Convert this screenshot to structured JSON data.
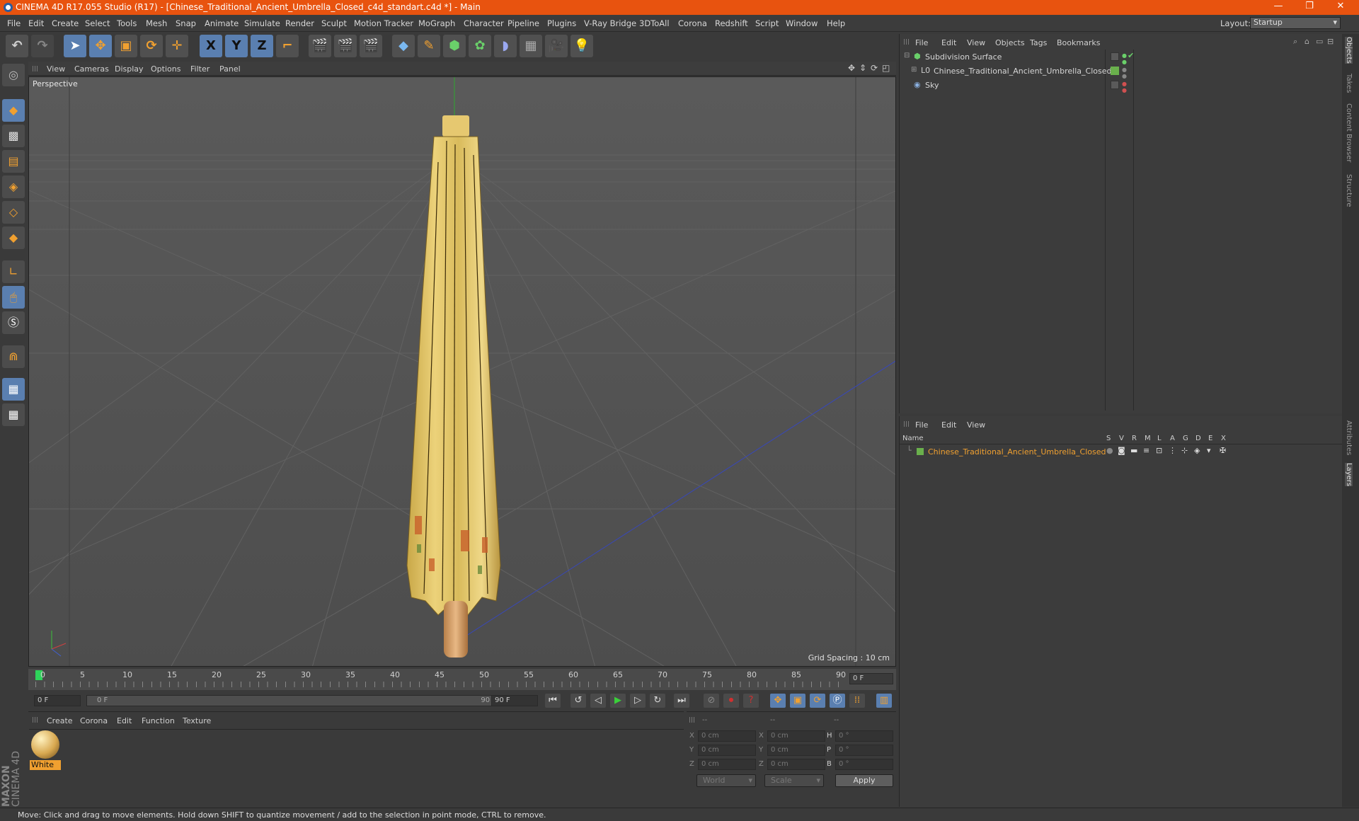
{
  "titlebar": {
    "title": "CINEMA 4D R17.055 Studio (R17) - [Chinese_Traditional_Ancient_Umbrella_Closed_c4d_standart.c4d *] - Main",
    "minimize": "—",
    "restore": "❐",
    "close": "✕"
  },
  "menubar": {
    "items": [
      "File",
      "Edit",
      "Create",
      "Select",
      "Tools",
      "Mesh",
      "Snap",
      "Animate",
      "Simulate",
      "Render",
      "Sculpt",
      "Motion Tracker",
      "MoGraph",
      "Character",
      "Pipeline",
      "Plugins",
      "V-Ray Bridge",
      "3DToAll",
      "Corona",
      "Redshift",
      "Script",
      "Window",
      "Help"
    ],
    "layout_label": "Layout:",
    "layout_value": "Startup"
  },
  "toolbar": {
    "x_label": "X",
    "y_label": "Y",
    "z_label": "Z"
  },
  "viewport": {
    "menu": [
      "View",
      "Cameras",
      "Display",
      "Options",
      "Filter",
      "Panel"
    ],
    "label": "Perspective",
    "grid_spacing": "Grid Spacing : 10 cm"
  },
  "timeline": {
    "ticks": [
      "0",
      "5",
      "10",
      "15",
      "20",
      "25",
      "30",
      "35",
      "40",
      "45",
      "50",
      "55",
      "60",
      "65",
      "70",
      "75",
      "80",
      "85",
      "90"
    ],
    "current_frame": "0 F",
    "start_field": "0 F",
    "range_start": "0 F",
    "range_end": "90 F",
    "end_field": "90 F"
  },
  "materials": {
    "menu": [
      "Create",
      "Corona",
      "Edit",
      "Function",
      "Texture"
    ],
    "items": [
      {
        "name": "White"
      }
    ]
  },
  "coords": {
    "headers": [
      "--",
      "--",
      "--"
    ],
    "rows": [
      {
        "a": "X",
        "av": "0 cm",
        "b": "X",
        "bv": "0 cm",
        "c": "H",
        "cv": "0 °"
      },
      {
        "a": "Y",
        "av": "0 cm",
        "b": "Y",
        "bv": "0 cm",
        "c": "P",
        "cv": "0 °"
      },
      {
        "a": "Z",
        "av": "0 cm",
        "b": "Z",
        "bv": "0 cm",
        "c": "B",
        "cv": "0 °"
      }
    ],
    "world": "World",
    "scale": "Scale",
    "apply": "Apply"
  },
  "objects": {
    "menu": [
      "File",
      "Edit",
      "View",
      "Objects",
      "Tags",
      "Bookmarks"
    ],
    "items": [
      {
        "name": "Subdivision Surface"
      },
      {
        "name": "Chinese_Traditional_Ancient_Umbrella_Closed"
      },
      {
        "name": "Sky"
      }
    ]
  },
  "layers": {
    "menu": [
      "File",
      "Edit",
      "View"
    ],
    "col_name": "Name",
    "cols": [
      "S",
      "V",
      "R",
      "M",
      "L",
      "A",
      "G",
      "D",
      "E",
      "X"
    ],
    "items": [
      {
        "name": "Chinese_Traditional_Ancient_Umbrella_Closed"
      }
    ]
  },
  "rightstrip": {
    "tabs": [
      "Objects",
      "Takes",
      "Content Browser",
      "Structure"
    ],
    "tabs2": [
      "Attributes",
      "Layers"
    ]
  },
  "status": {
    "text": "Move: Click and drag to move elements. Hold down SHIFT to quantize movement / add to the selection in point mode, CTRL to remove."
  },
  "brand": {
    "line1": "MAXON",
    "line2": "CINEMA 4D"
  },
  "colors": {
    "accent": "#e8530f",
    "active": "#5a7fb0",
    "layer_green": "#6ab04c",
    "selection_orange": "#f0a030"
  }
}
